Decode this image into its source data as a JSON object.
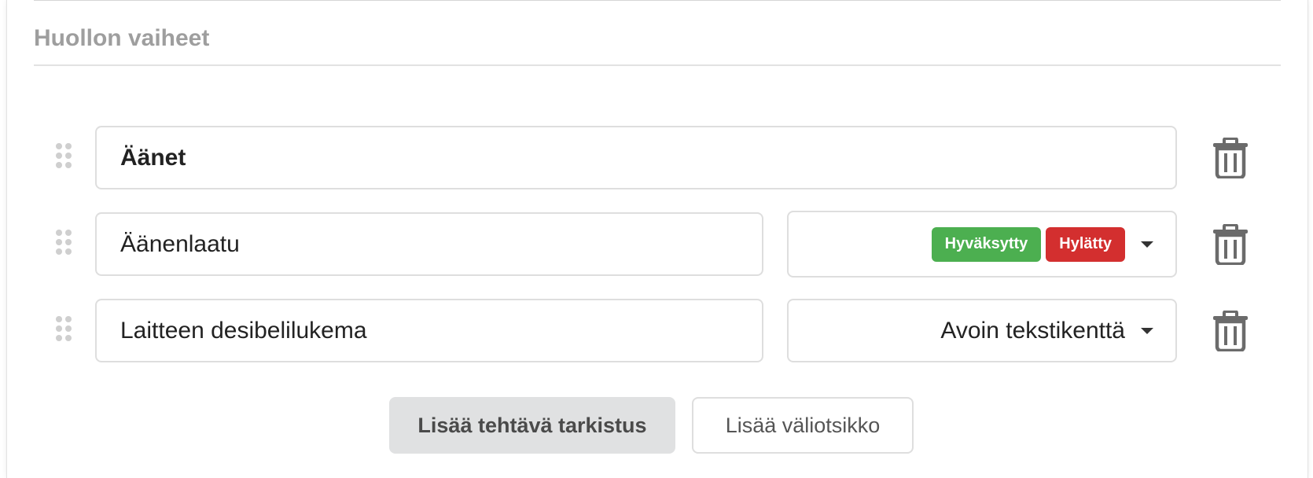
{
  "section": {
    "title": "Huollon vaiheet"
  },
  "rows": [
    {
      "name": "Äänet",
      "type": "header"
    },
    {
      "name": "Äänenlaatu",
      "type": "choice",
      "options": [
        {
          "label": "Hyväksytty",
          "color": "#4caf50"
        },
        {
          "label": "Hylätty",
          "color": "#d32f2f"
        }
      ]
    },
    {
      "name": "Laitteen desibelilukema",
      "type": "text",
      "select_value": "Avoin tekstikenttä"
    }
  ],
  "actions": {
    "add_task": "Lisää tehtävä tarkistus",
    "add_subheading": "Lisää väliotsikko"
  },
  "icons": {
    "drag": "drag-handle-icon",
    "delete": "trash-icon",
    "dropdown": "chevron-down-icon"
  },
  "colors": {
    "approved": "#4caf50",
    "rejected": "#d32f2f",
    "muted_text": "#9e9e9e"
  }
}
